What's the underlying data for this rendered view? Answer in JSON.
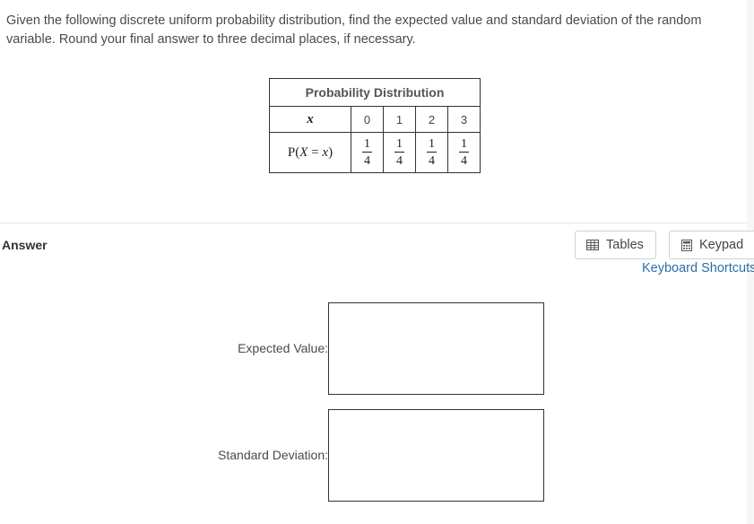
{
  "question": {
    "text": "Given the following discrete uniform probability distribution, find the expected value and standard deviation of the random variable. Round your final answer to three decimal places, if necessary."
  },
  "table": {
    "caption": "Probability Distribution",
    "x_label": "x",
    "px_label_p": "P(",
    "px_label_x1": "X",
    "px_label_eq": " = ",
    "px_label_x2": "x",
    "px_label_close": ")",
    "x_values": [
      "0",
      "1",
      "2",
      "3"
    ],
    "probabilities": [
      {
        "num": "1",
        "den": "4"
      },
      {
        "num": "1",
        "den": "4"
      },
      {
        "num": "1",
        "den": "4"
      },
      {
        "num": "1",
        "den": "4"
      }
    ]
  },
  "answer": {
    "heading": "Answer",
    "tables_button": "Tables",
    "keypad_button": "Keypad",
    "shortcuts_link": "Keyboard Shortcuts",
    "expected_value_label": "Expected Value:",
    "standard_deviation_label": "Standard Deviation:",
    "expected_value": "",
    "standard_deviation": ""
  },
  "icons": {
    "tables": "table-grid-icon",
    "keypad": "calculator-icon"
  }
}
